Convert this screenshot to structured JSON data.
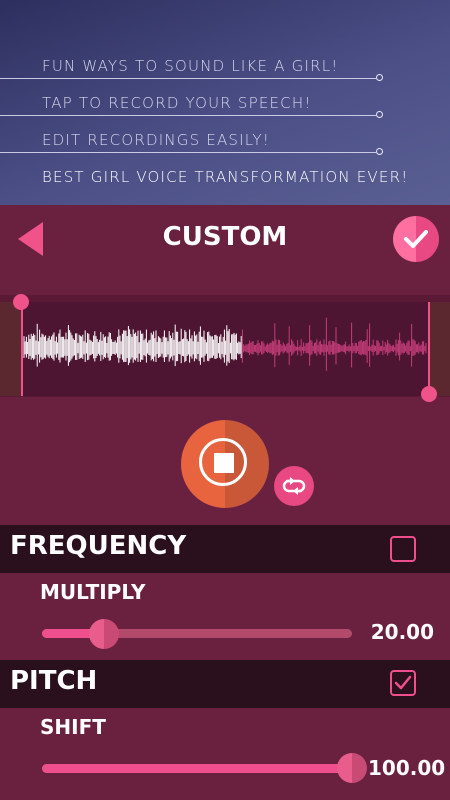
{
  "banner": {
    "lines": [
      "FUN WAYS TO SOUND LIKE A GIRL!",
      "TAP TO RECORD YOUR SPEECH!",
      "EDIT RECORDINGS EASILY!",
      "BEST GIRL VOICE TRANSFORMATION EVER!"
    ]
  },
  "header": {
    "title": "CUSTOM"
  },
  "colors": {
    "accent": "#f0528a",
    "record": "#e8643f",
    "section_bg": "#2a0f1d",
    "panel_bg": "#6a2140"
  },
  "icons": {
    "back": "back-triangle-icon",
    "confirm": "checkmark-icon",
    "record": "stop-icon",
    "loop": "loop-icon"
  },
  "frequency": {
    "label": "FREQUENCY",
    "checked": false,
    "param_label": "MULTIPLY",
    "value": "20.00",
    "slider_fraction": 0.2
  },
  "pitch": {
    "label": "PITCH",
    "checked": true,
    "param_label": "SHIFT",
    "value": "100.00",
    "slider_fraction": 1.0
  }
}
